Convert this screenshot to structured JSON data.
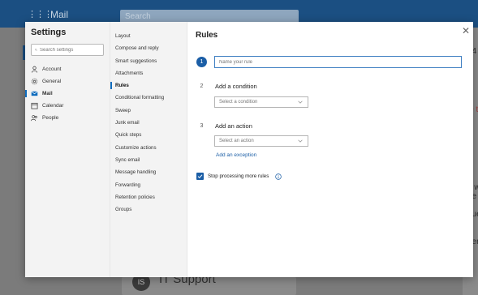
{
  "background": {
    "app_name": "Mail",
    "search_placeholder": "Search",
    "card_avatar": "IS",
    "card_title": "IT Support",
    "right_fragments": [
      "34",
      "le t",
      "d w",
      "he",
      "que",
      "ner"
    ]
  },
  "settings": {
    "title": "Settings",
    "search_placeholder": "Search settings",
    "nav": [
      {
        "label": "Account",
        "icon": "person-icon"
      },
      {
        "label": "General",
        "icon": "gear-icon"
      },
      {
        "label": "Mail",
        "icon": "mail-icon"
      },
      {
        "label": "Calendar",
        "icon": "calendar-icon"
      },
      {
        "label": "People",
        "icon": "people-icon"
      }
    ],
    "active_nav": "Mail"
  },
  "mail_sections": [
    "Layout",
    "Compose and reply",
    "Smart suggestions",
    "Attachments",
    "Rules",
    "Conditional formatting",
    "Sweep",
    "Junk email",
    "Quick steps",
    "Customize actions",
    "Sync email",
    "Message handling",
    "Forwarding",
    "Retention policies",
    "Groups"
  ],
  "active_section": "Rules",
  "rules": {
    "title": "Rules",
    "close_icon": "close-icon",
    "step1": {
      "number": "1",
      "placeholder": "Name your rule"
    },
    "step2": {
      "number": "2",
      "label": "Add a condition",
      "select": "Select a condition"
    },
    "step3": {
      "number": "3",
      "label": "Add an action",
      "select": "Select an action"
    },
    "add_exception": "Add an exception",
    "stop_processing": "Stop processing more rules",
    "stop_processing_checked": true
  },
  "colors": {
    "accent": "#1b5ea6",
    "topbar": "#1b4f82"
  }
}
